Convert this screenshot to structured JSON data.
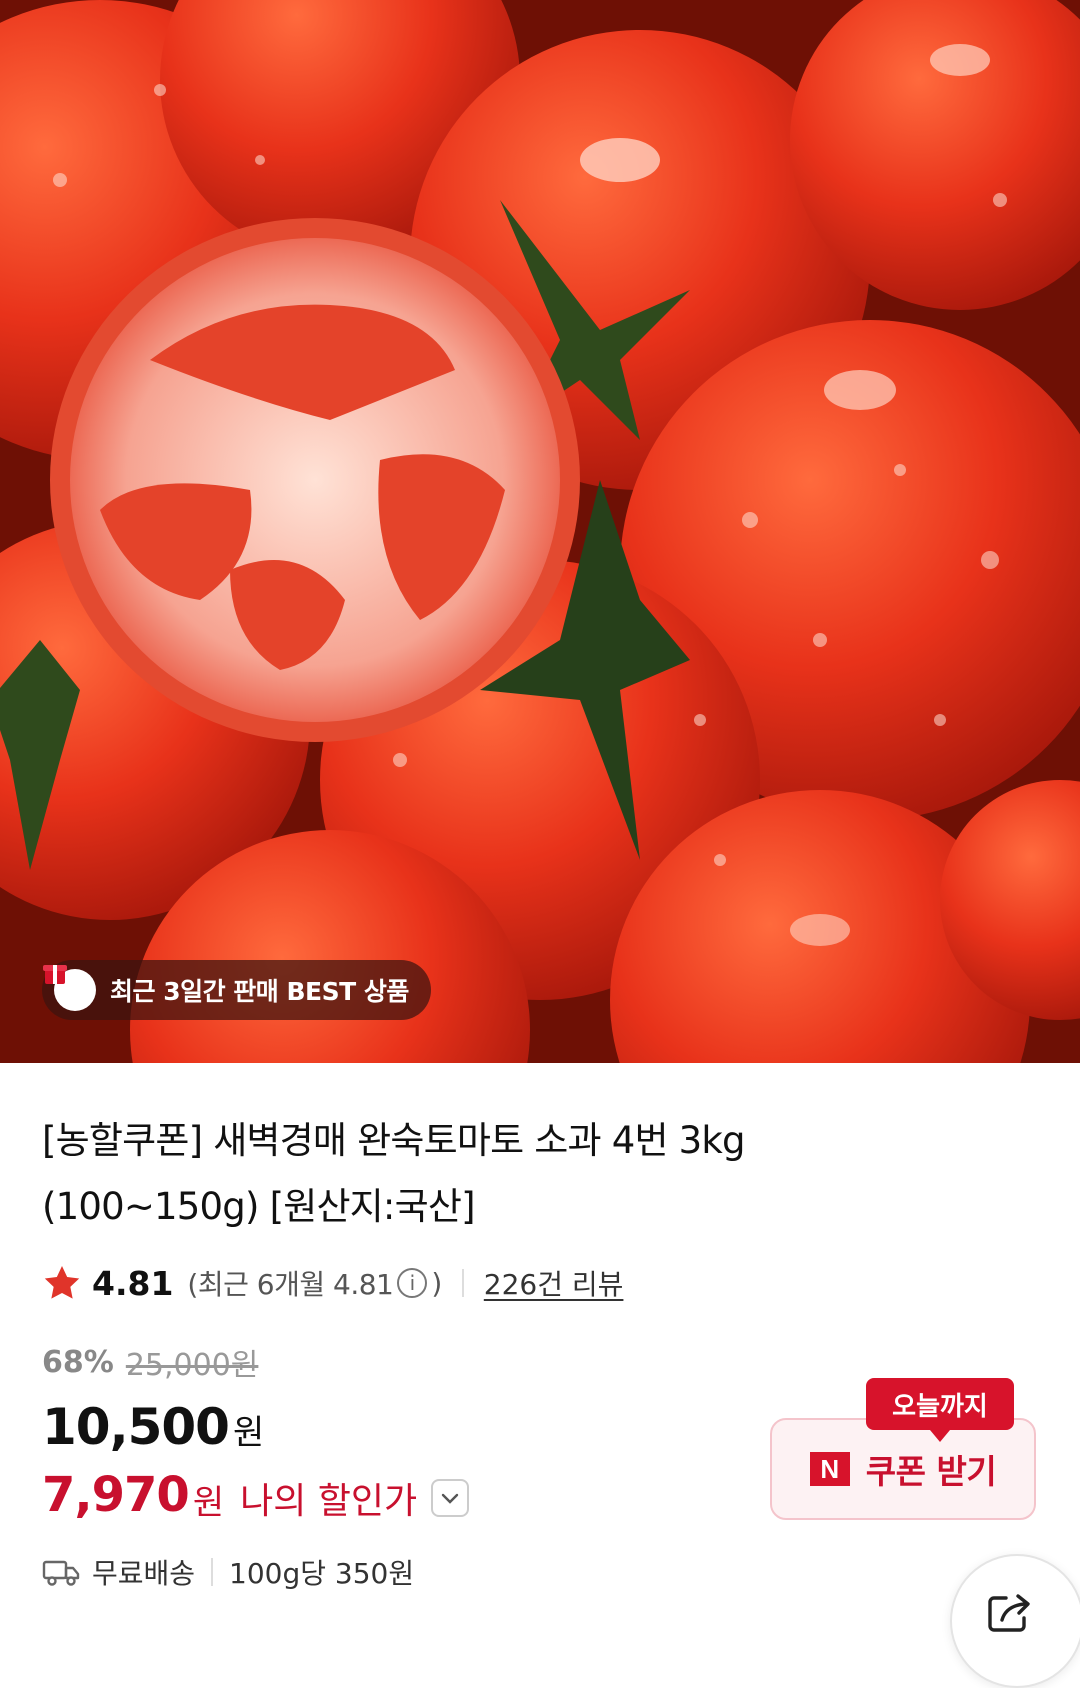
{
  "hero": {
    "image_alt": "",
    "badge_text": "최근 3일간 판매 BEST 상품"
  },
  "product": {
    "title": "[농할쿠폰] 새벽경매 완숙토마토 소과 4번 3kg (100~150g) [원산지:국산]",
    "rating": "4.81",
    "recent_rating_prefix": "(최근 6개월 4.81",
    "recent_rating_suffix": ")",
    "info_glyph": "i",
    "reviews": "226건 리뷰",
    "discount_pct": "68%",
    "original_price": "25,000원",
    "price": "10,500",
    "price_unit": "원",
    "my_price": "7,970",
    "my_price_unit": "원",
    "my_price_label": "나의 할인가",
    "shipping": "무료배송",
    "unit_price": "100g당 350원"
  },
  "coupon": {
    "tag": "오늘까지",
    "logo": "N",
    "label": "쿠폰 받기"
  },
  "icons": {
    "badge": "gift-box-icon",
    "star": "star-icon",
    "info": "info-icon",
    "chevron": "chevron-down-icon",
    "shipping": "truck-icon",
    "share": "share-icon"
  },
  "colors": {
    "accent": "#c8102e",
    "coupon_bg": "#fdf2f3",
    "star": "#e0342a"
  }
}
